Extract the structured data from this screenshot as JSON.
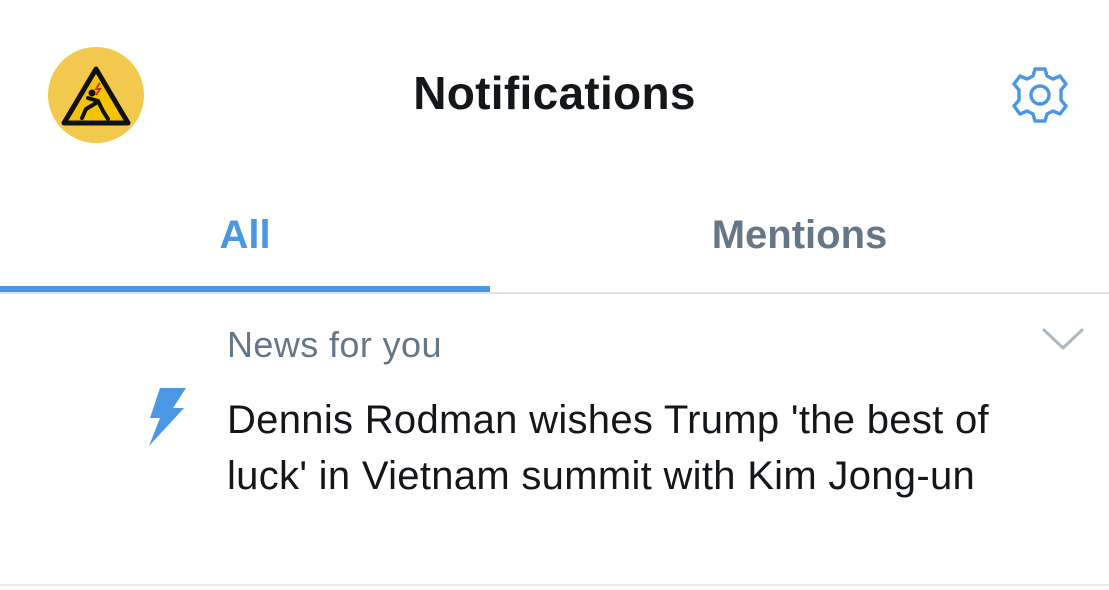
{
  "header": {
    "title": "Notifications",
    "avatar_icon": "warning-sign-icon",
    "settings_icon": "gear-icon"
  },
  "tabs": [
    {
      "label": "All",
      "active": true
    },
    {
      "label": "Mentions",
      "active": false
    }
  ],
  "notifications": [
    {
      "type_icon": "lightning-bolt-icon",
      "category": "News for you",
      "headline": "Dennis Rodman wishes Trump 'the best of luck' in Vietnam summit with Kim Jong-un",
      "menu_icon": "chevron-down-icon"
    }
  ],
  "colors": {
    "accent": "#4a97e3",
    "text_primary": "#14171a",
    "text_secondary": "#657786",
    "avatar_bg": "#f2c94c",
    "divider": "#dfe3e8"
  }
}
